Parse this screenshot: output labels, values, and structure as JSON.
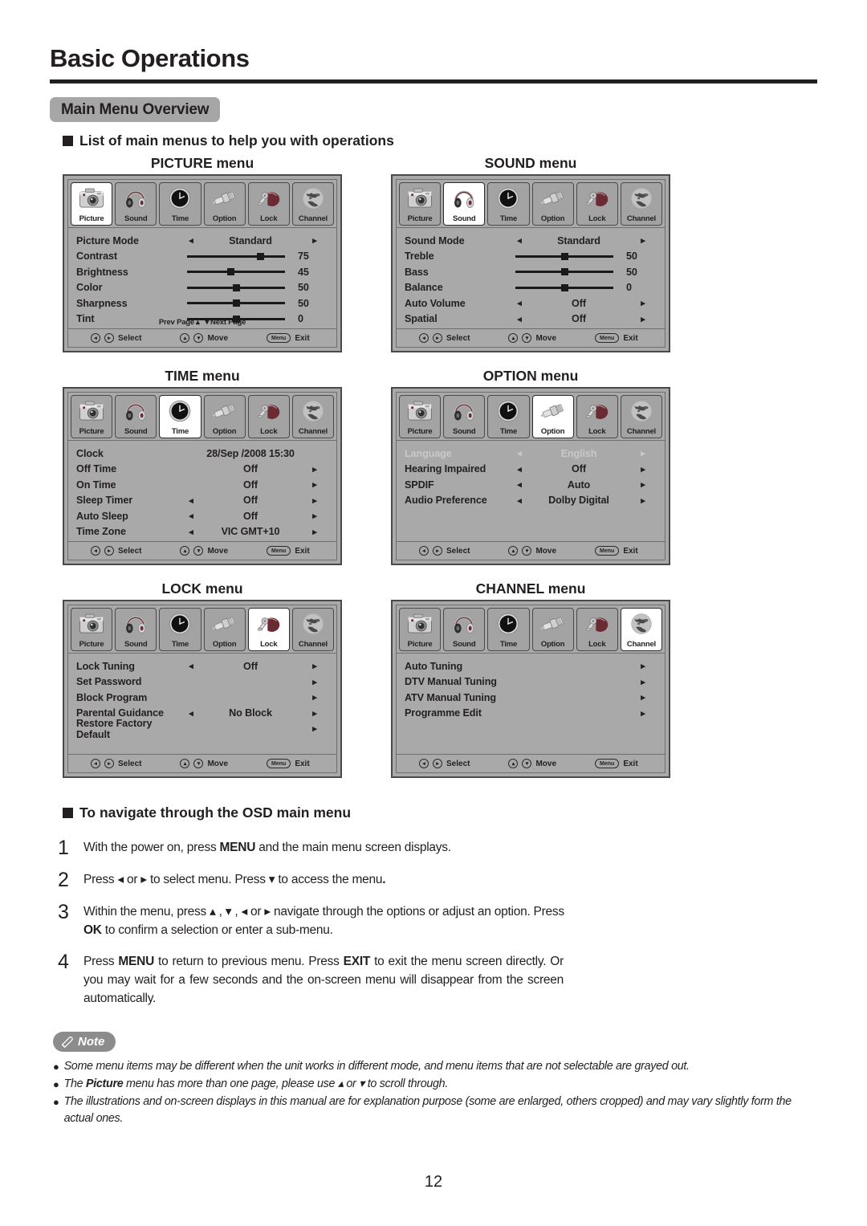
{
  "page": {
    "title": "Basic Operations",
    "section": "Main Menu Overview",
    "number": "12"
  },
  "headings": {
    "list": "List of main menus to help you with operations",
    "navigate": "To navigate through the OSD main menu"
  },
  "tab_labels": [
    "Picture",
    "Sound",
    "Time",
    "Option",
    "Lock",
    "Channel"
  ],
  "footer": {
    "select": "Select",
    "move": "Move",
    "exit": "Exit",
    "menu_key": "Menu",
    "left_glyph": "◂",
    "right_glyph": "▸",
    "up_glyph": "▴",
    "down_glyph": "▾"
  },
  "arrows": {
    "left": "◂",
    "right": "▸"
  },
  "menus": [
    {
      "title": "PICTURE menu",
      "active_tab": 0,
      "page_hint_prev": "Prev  Page",
      "page_hint_next": "Next  Page",
      "rows": [
        {
          "label": "Picture Mode",
          "type": "option",
          "value": "Standard",
          "left": true,
          "right": true
        },
        {
          "label": "Contrast",
          "type": "slider",
          "pct": 75,
          "num": "75"
        },
        {
          "label": "Brightness",
          "type": "slider",
          "pct": 45,
          "num": "45"
        },
        {
          "label": "Color",
          "type": "slider",
          "pct": 50,
          "num": "50"
        },
        {
          "label": "Sharpness",
          "type": "slider",
          "pct": 50,
          "num": "50"
        },
        {
          "label": "Tint",
          "type": "slider",
          "pct": 50,
          "num": "0"
        }
      ]
    },
    {
      "title": "SOUND menu",
      "active_tab": 1,
      "rows": [
        {
          "label": "Sound Mode",
          "type": "option",
          "value": "Standard",
          "left": true,
          "right": true
        },
        {
          "label": "Treble",
          "type": "slider",
          "pct": 50,
          "num": "50"
        },
        {
          "label": "Bass",
          "type": "slider",
          "pct": 50,
          "num": "50"
        },
        {
          "label": "Balance",
          "type": "slider",
          "pct": 50,
          "num": "0"
        },
        {
          "label": "Auto Volume",
          "type": "option",
          "value": "Off",
          "left": true,
          "right": true
        },
        {
          "label": "Spatial",
          "type": "option",
          "value": "Off",
          "left": true,
          "right": true
        }
      ]
    },
    {
      "title": "TIME menu",
      "active_tab": 2,
      "rows": [
        {
          "label": "Clock",
          "type": "option",
          "value": "28/Sep  /2008 15:30",
          "left": false,
          "right": false
        },
        {
          "label": "Off Time",
          "type": "option",
          "value": "Off",
          "left": false,
          "right": true
        },
        {
          "label": "On Time",
          "type": "option",
          "value": "Off",
          "left": false,
          "right": true
        },
        {
          "label": "Sleep Timer",
          "type": "option",
          "value": "Off",
          "left": true,
          "right": true
        },
        {
          "label": "Auto Sleep",
          "type": "option",
          "value": "Off",
          "left": true,
          "right": true
        },
        {
          "label": "Time Zone",
          "type": "option",
          "value": "VIC GMT+10",
          "left": true,
          "right": true
        }
      ]
    },
    {
      "title": "OPTION menu",
      "active_tab": 3,
      "rows": [
        {
          "label": "Language",
          "type": "option",
          "value": "English",
          "left": true,
          "right": true,
          "dim": true
        },
        {
          "label": "Hearing Impaired",
          "type": "option",
          "value": "Off",
          "left": true,
          "right": true
        },
        {
          "label": "SPDIF",
          "type": "option",
          "value": "Auto",
          "left": true,
          "right": true
        },
        {
          "label": "Audio Preference",
          "type": "option",
          "value": "Dolby Digital",
          "left": true,
          "right": true
        }
      ]
    },
    {
      "title": "LOCK menu",
      "active_tab": 4,
      "rows": [
        {
          "label": "Lock Tuning",
          "type": "option",
          "value": "Off",
          "left": true,
          "right": true
        },
        {
          "label": "Set Password",
          "type": "option",
          "value": "",
          "left": false,
          "right": true
        },
        {
          "label": "Block Program",
          "type": "option",
          "value": "",
          "left": false,
          "right": true
        },
        {
          "label": "Parental Guidance",
          "type": "option",
          "value": "No Block",
          "left": true,
          "right": true
        },
        {
          "label": "Restore Factory Default",
          "type": "option",
          "value": "",
          "left": false,
          "right": true
        }
      ]
    },
    {
      "title": "CHANNEL menu",
      "active_tab": 5,
      "rows": [
        {
          "label": "Auto Tuning",
          "type": "option",
          "value": "",
          "left": false,
          "right": true
        },
        {
          "label": "DTV Manual Tuning",
          "type": "option",
          "value": "",
          "left": false,
          "right": true
        },
        {
          "label": "ATV Manual Tuning",
          "type": "option",
          "value": "",
          "left": false,
          "right": true
        },
        {
          "label": "Programme Edit",
          "type": "option",
          "value": "",
          "left": false,
          "right": true
        }
      ]
    }
  ],
  "steps": [
    {
      "num": "1",
      "html": "With the power on, press <b>MENU</b> and the main menu screen displays."
    },
    {
      "num": "2",
      "html": "Press ◂ or ▸ to select menu.  Press ▾  to access the menu<b>.</b>"
    },
    {
      "num": "3",
      "html": "Within the menu, press ▴ , ▾ , ◂ or ▸ navigate through the options or adjust an option. Press <b>OK</b> to confirm a selection or enter a sub-menu."
    },
    {
      "num": "4",
      "html": "Press <b>MENU</b> to return to previous menu. Press <b>EXIT</b> to exit the menu screen directly. Or you may wait for a few seconds and the on-screen menu will disappear from the screen automatically."
    }
  ],
  "note": {
    "label": "Note",
    "items": [
      "Some menu items may be different when the unit works in different mode, and menu items that are not selectable are grayed out.",
      "The <b>Picture</b> menu has more than one page, please use ▴ or ▾ to scroll through.",
      "The illustrations and on-screen displays in this manual are for explanation purpose (some are enlarged, others cropped) and may vary slightly form the actual ones."
    ]
  },
  "colors": {
    "ink": "#231f20",
    "pill_gray": "#a6a6a6",
    "osd_bg": "#a9a9a9",
    "note_gray": "#8c8c8c",
    "accent_maroon": "#6b2b33"
  }
}
